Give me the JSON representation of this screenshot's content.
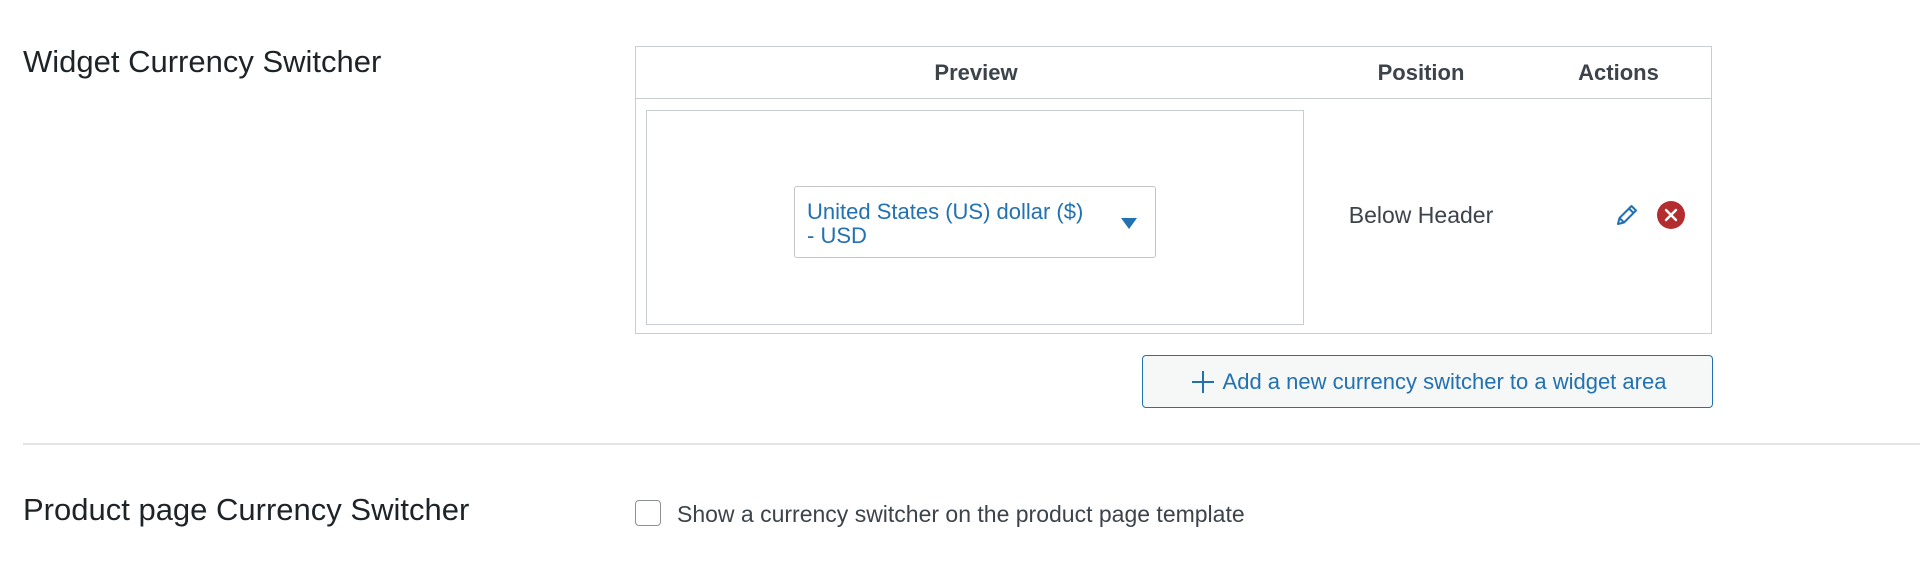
{
  "widget_section": {
    "title": "Widget Currency Switcher",
    "table": {
      "headers": {
        "preview": "Preview",
        "position": "Position",
        "actions": "Actions"
      },
      "rows": [
        {
          "currency_selected": "United States (US) dollar ($) - USD",
          "position": "Below Header",
          "actions": [
            "pencil-icon",
            "delete-icon"
          ]
        }
      ]
    },
    "add_button_label": "Add a new currency switcher to a widget area"
  },
  "product_section": {
    "title": "Product page Currency Switcher",
    "checkbox_label": "Show a currency switcher on the product page template",
    "checkbox_checked": false
  },
  "colors": {
    "accent": "#2271b1",
    "delete": "#b32d2e",
    "border": "#c9cdd2"
  }
}
